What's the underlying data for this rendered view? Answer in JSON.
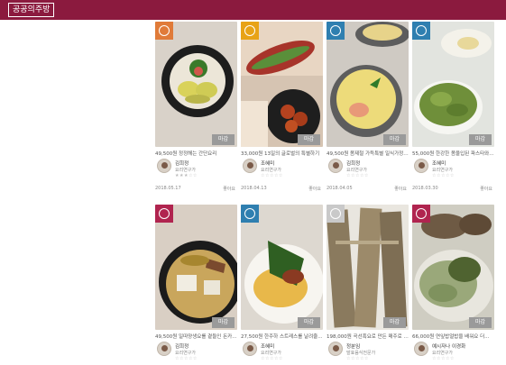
{
  "header": {
    "logo_text": "공공의주방"
  },
  "cards": [
    {
      "category": "bowl",
      "badge_color": "#e07b39",
      "tag": "마감",
      "title": "49,500원 정정해는 간단요리",
      "author": "김희정",
      "role": "요리연구가",
      "stars": "★★★☆☆",
      "date": "2018.05.17",
      "like": "좋아요"
    },
    {
      "category": "spoon",
      "badge_color": "#e8a317",
      "tag": "마감",
      "title": "33,000원 13일의 글로벌의 특별하기",
      "author": "조혜미",
      "role": "요리연구가",
      "stars": "☆☆☆☆☆",
      "date": "2018.04.13",
      "like": "좋아요"
    },
    {
      "category": "dish",
      "badge_color": "#2f7fb0",
      "tag": "마감",
      "title": "49,500원 봄제철 가득특별 일식가정식 ...",
      "author": "김희정",
      "role": "요리연구가",
      "stars": "☆☆☆☆☆",
      "date": "2018.04.05",
      "like": "좋아요"
    },
    {
      "category": "dish",
      "badge_color": "#2f7fb0",
      "tag": "마감",
      "title": "55,000원 한강한 봄울입된 파스타와...",
      "author": "조혜미",
      "role": "요리연구가",
      "stars": "☆☆☆☆☆",
      "date": "2018.03.30",
      "like": "좋아요"
    },
    {
      "category": "fork",
      "badge_color": "#b0244f",
      "tag": "마감",
      "title": "49,500원 일따양생요를 곁들인 돈카...",
      "author": "김희정",
      "role": "요리연구가",
      "stars": "☆☆☆☆☆",
      "date": "",
      "like": ""
    },
    {
      "category": "dish",
      "badge_color": "#2f7fb0",
      "tag": "마감",
      "title": "27,500원 한주하 스트레스를 날려줄...",
      "author": "조혜미",
      "role": "요리연구가",
      "stars": "☆☆☆☆☆",
      "date": "",
      "like": ""
    },
    {
      "category": "fork",
      "badge_color": "#c9c9c9",
      "tag": "마감",
      "title": "198,000원 곡선흑요로 만든 매주로 만...",
      "author": "정분임",
      "role": "발효음식전문가",
      "stars": "☆☆☆☆☆",
      "date": "",
      "like": ""
    },
    {
      "category": "fork",
      "badge_color": "#b0244f",
      "tag": "마감",
      "title": "66,000원 연잎밥얼밥을 배워요 더...",
      "author": "예시자나 이경화",
      "role": "요리연구가",
      "stars": "☆☆☆☆☆",
      "date": "",
      "like": ""
    }
  ]
}
